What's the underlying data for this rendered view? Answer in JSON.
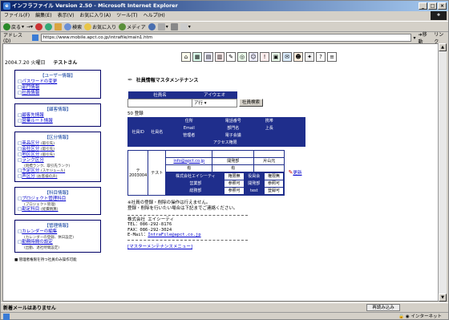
{
  "window": {
    "title": "インフラファイル Version 2.50 - Microsoft Internet Explorer"
  },
  "menubar": [
    "ファイル(F)",
    "編集(E)",
    "表示(V)",
    "お気に入り(A)",
    "ツール(T)",
    "ヘルプ(H)"
  ],
  "toolbar": {
    "back": "戻る",
    "search": "検索",
    "favorites": "お気に入り",
    "media": "メディア"
  },
  "address": {
    "label": "アドレス(D)",
    "url": "https://www.mobile.apct.co.jp/intrafile/main1.htm",
    "go": "移動",
    "links": "リンク"
  },
  "header": {
    "date": "2004.7.20 火曜日",
    "user": "テストさん"
  },
  "nav": [
    {
      "heading": "【ユーザー情報】",
      "items": [
        {
          "label": "パスワードの変更"
        },
        {
          "label": "部門情報"
        },
        {
          "label": "社員情報"
        }
      ]
    },
    {
      "heading": "【顧客情報】",
      "items": [
        {
          "label": "顧客先情報"
        },
        {
          "label": "営業ルート情報"
        }
      ]
    },
    {
      "heading": "【区分情報】",
      "items": [
        {
          "label": "商品区分",
          "sub": "(取引先)"
        },
        {
          "label": "会社区分",
          "sub": "(取引先)"
        },
        {
          "label": "地区区分",
          "sub": "(取引先)"
        },
        {
          "label": "ランク区分",
          "sub": "(目標ランク、取引先ランク)"
        },
        {
          "label": "予定区分",
          "sub": "(スケジュール)"
        },
        {
          "label": "声区分",
          "sub": "(お客様の声)"
        }
      ]
    },
    {
      "heading": "【科目情報】",
      "items": [
        {
          "label": "プロジェクト管理科目",
          "sub": "(プロジェクト管理)"
        },
        {
          "label": "勘定科目",
          "sub": "(経費精算)"
        }
      ]
    },
    {
      "heading": "【管理情報】",
      "items": [
        {
          "label": "カレンダーの編集",
          "sub": "(カレンダーの登録、休日設定)"
        },
        {
          "label": "勤務時間の設定",
          "sub": "(出勤、退社時間設定)"
        }
      ]
    }
  ],
  "nav_note": "管理者権限を持つ社員のみ操作可能",
  "page": {
    "title": "社員情報マスタメンテナンス",
    "search": {
      "col1": "社員名",
      "col2": "アイウエオ",
      "kana_value": "ア行",
      "button": "社員検索"
    },
    "count": "50 登録",
    "grid": {
      "headers": {
        "id": "社員ID",
        "name": "社員名",
        "dept": "住所",
        "tel": "電話番号",
        "mobile": "携帯",
        "email": "Email",
        "dept_name": "部門名",
        "boss": "上長",
        "admin": "管理者",
        "ejournal": "電子会議",
        "access": "アクセス権限"
      },
      "row": {
        "marker": "テ",
        "id": "2003004",
        "name": "テスト",
        "yes1": "有",
        "yes2": "有",
        "email": "info@apct.co.jp",
        "dept": "開発部",
        "boss": "片山元",
        "access": [
          [
            "株式会社エイシーティ",
            "権限無",
            "役員会",
            "権限無"
          ],
          [
            "営業部",
            "参照可",
            "開発部",
            "参照可"
          ],
          [
            "総務部",
            "参照可",
            "test",
            "登録可"
          ]
        ],
        "edit": "更新"
      }
    },
    "notes": [
      "※社員の登録・削除の操作は行えません。",
      "登録・削除を行いたい場合は下記までご連絡ください。"
    ],
    "contact": {
      "company": "株式会社 エイシーティ",
      "tel": "TEL：086-292-8176",
      "fax": "FAX：086-292-3024",
      "mail_label": "E-Mail：",
      "mail": "IntraFile@apct.co.jp"
    },
    "menu_link": "[マスターメンテナンスメニュー]"
  },
  "status": {
    "text": "新着メールはありません",
    "reload": "再読み込み",
    "zone": "インターネット"
  }
}
